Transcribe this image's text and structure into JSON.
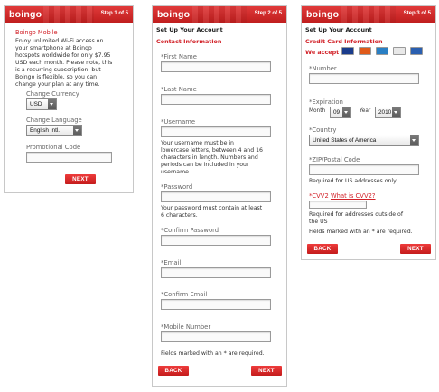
{
  "brand": {
    "logo": "boingo"
  },
  "step1": {
    "step_label": "Step 1 of 5",
    "title": "Boingo Mobile",
    "description": [
      "Enjoy unlimited Wi-Fi access on",
      "your smartphone at Boingo",
      "hotspots worldwide for only $7.95",
      "USD each month. Please note, this",
      "is a recurring subscription, but",
      "Boingo is flexible, so you can",
      "change your plan at any time."
    ],
    "currency_label": "Change Currency",
    "currency_value": "USD",
    "language_label": "Change Language",
    "language_value": "English Intl.",
    "promo_label": "Promotional Code",
    "promo_value": "",
    "next_label": "NEXT"
  },
  "step2": {
    "step_label": "Step 2 of 5",
    "title": "Set Up Your Account",
    "subtitle": "Contact Information",
    "first_name_label": "*First Name",
    "last_name_label": "*Last Name",
    "username_label": "*Username",
    "username_help": [
      "Your username must be in",
      "lowercase letters, between 4 and 16",
      "characters in length. Numbers and",
      "periods can be included in your",
      "username."
    ],
    "password_label": "*Password",
    "password_help": [
      "Your password must contain at least",
      "6 characters."
    ],
    "confirm_password_label": "*Confirm Password",
    "email_label": "*Email",
    "confirm_email_label": "*Confirm Email",
    "mobile_label": "*Mobile Number",
    "required_note": "Fields marked with an * are required.",
    "back_label": "BACK",
    "next_label": "NEXT"
  },
  "step3": {
    "step_label": "Step 3 of 5",
    "title": "Set Up Your Account",
    "subtitle": "Credit Card Information",
    "we_accept": "We accept",
    "cards": [
      {
        "name": "VISA",
        "color": "#1a3c8c"
      },
      {
        "name": "MC",
        "color": "#e05a1a"
      },
      {
        "name": "AMEX",
        "color": "#2a7fc4"
      },
      {
        "name": "DISCOVER",
        "color": "#e8e8e8"
      },
      {
        "name": "JCB",
        "color": "#2a5fb0"
      }
    ],
    "number_label": "*Number",
    "expiration_label": "*Expiration",
    "month_label": "Month",
    "month_value": "09",
    "year_label": "Year",
    "year_value": "2010",
    "country_label": "*Country",
    "country_value": "United States of America",
    "zip_label": "*ZIP/Postal Code",
    "zip_help": "Required for US addresses only",
    "cvv_label": "*CVV2",
    "cvv_link": "What is CVV2?",
    "cvv_help": [
      "Required for addresses outside of",
      "the US"
    ],
    "required_note": "Fields marked with an * are required.",
    "back_label": "BACK",
    "next_label": "NEXT"
  }
}
